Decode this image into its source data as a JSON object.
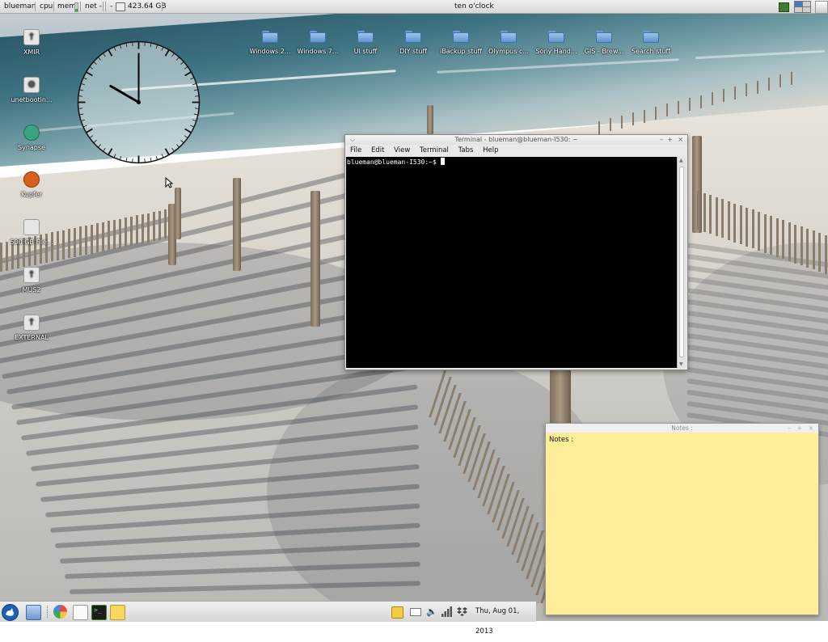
{
  "top_panel": {
    "user": "blueman",
    "cpu_label": "cpu",
    "mem_label": "mem",
    "mem_level": 0.35,
    "net_label": "net -",
    "dash_label": "-",
    "disk_free": "423.64 GB",
    "fuzzy_clock": "ten o'clock"
  },
  "desktop_left_icons": [
    {
      "label": "XMIR",
      "icon": "usb-drive-icon"
    },
    {
      "label": "unetbootin...",
      "icon": "gear-icon"
    },
    {
      "label": "Synapse",
      "icon": "synapse-icon"
    },
    {
      "label": "Kupfer",
      "icon": "kupfer-icon"
    },
    {
      "label": "500 GB File...",
      "icon": "hard-drive-icon"
    },
    {
      "label": "MUS2",
      "icon": "usb-drive-icon"
    },
    {
      "label": "EXTERNAL",
      "icon": "usb-drive-icon"
    }
  ],
  "desktop_folders": [
    {
      "label": "Windows 2..."
    },
    {
      "label": "Windows 7..."
    },
    {
      "label": "UI stuff"
    },
    {
      "label": "DIY stuff"
    },
    {
      "label": "iBackup stuff"
    },
    {
      "label": "Olympus c..."
    },
    {
      "label": "Sony Hand..."
    },
    {
      "label": "GIS - Brew..."
    },
    {
      "label": "Search stuff"
    }
  ],
  "clock_widget": {
    "hour": 10,
    "minute": 0
  },
  "terminal": {
    "title": "Terminal - blueman@blueman-I530: ~",
    "menu": [
      "File",
      "Edit",
      "View",
      "Terminal",
      "Tabs",
      "Help"
    ],
    "prompt": "blueman@blueman-I530:~$"
  },
  "notes": {
    "title": "Notes :",
    "content": "Notes :"
  },
  "bottom_panel": {
    "clock": "Thu, Aug 01, 2013"
  },
  "colors": {
    "notes_bg": "#ffee99",
    "terminal_bg": "#000000",
    "accent_blue": "#3b74c9"
  }
}
